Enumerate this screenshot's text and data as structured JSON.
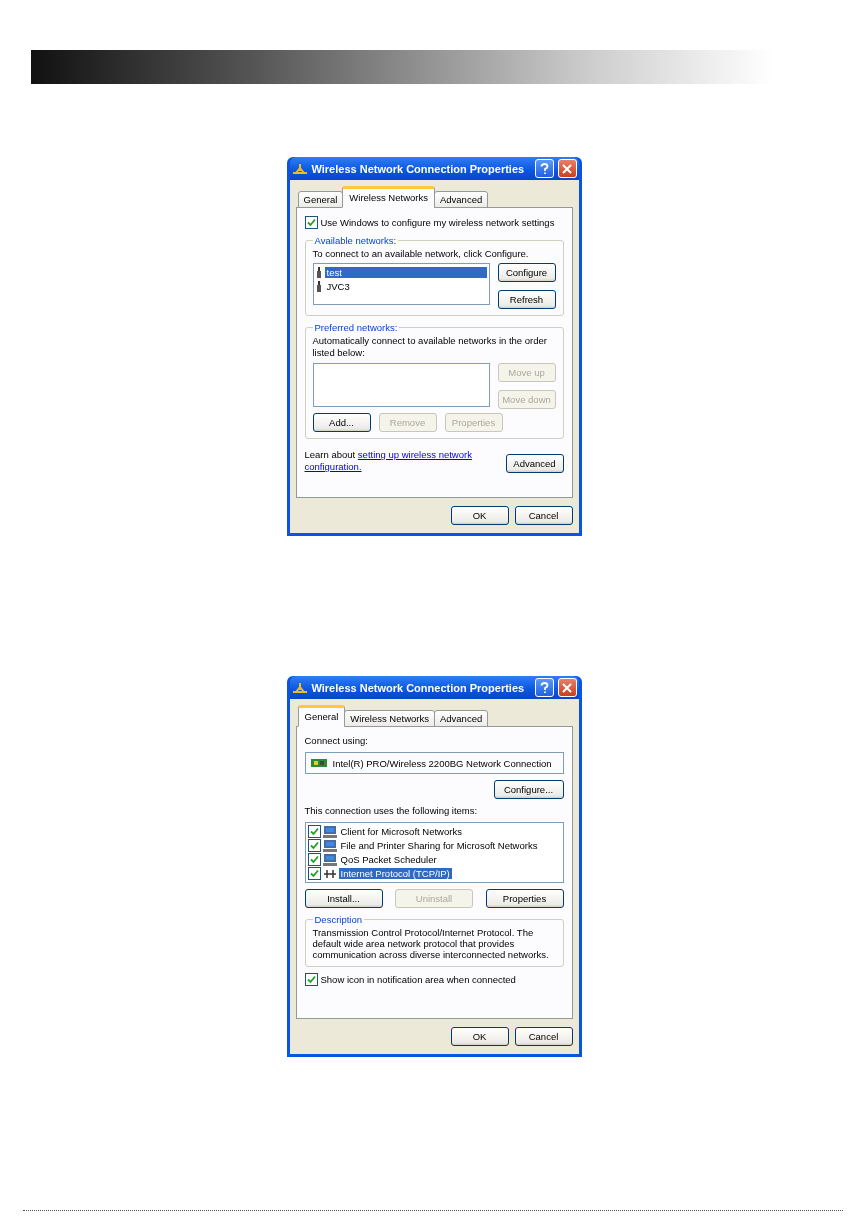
{
  "dialogs": [
    {
      "kind": "wireless",
      "title": "Wireless Network Connection Properties",
      "tabs": [
        {
          "label": "General",
          "selected": false
        },
        {
          "label": "Wireless Networks",
          "selected": true
        },
        {
          "label": "Advanced",
          "selected": false
        }
      ],
      "use_windows": {
        "label": "Use Windows to configure my wireless network settings",
        "checked": true
      },
      "available": {
        "legend": "Available networks:",
        "instruction": "To connect to an available network, click Configure.",
        "networks": [
          {
            "name": "test",
            "selected": true
          },
          {
            "name": "JVC3",
            "selected": false
          }
        ],
        "buttons": [
          {
            "label": "Configure",
            "disabled": false
          },
          {
            "label": "Refresh",
            "disabled": false
          }
        ]
      },
      "preferred": {
        "legend": "Preferred networks:",
        "instruction": "Automatically connect to available networks in the order listed below:",
        "side_buttons": [
          {
            "label": "Move up",
            "disabled": true
          },
          {
            "label": "Move down",
            "disabled": true
          }
        ],
        "buttons": [
          {
            "label": "Add...",
            "disabled": false
          },
          {
            "label": "Remove",
            "disabled": true
          },
          {
            "label": "Properties",
            "disabled": true
          }
        ]
      },
      "learn": {
        "text": "Learn about",
        "link_lines": [
          "setting up wireless network",
          "configuration."
        ]
      },
      "advanced_button": {
        "label": "Advanced",
        "disabled": false
      },
      "footer": [
        {
          "label": "OK",
          "disabled": false
        },
        {
          "label": "Cancel",
          "disabled": false
        }
      ]
    },
    {
      "kind": "general",
      "title": "Wireless Network Connection Properties",
      "tabs": [
        {
          "label": "General",
          "selected": true
        },
        {
          "label": "Wireless Networks",
          "selected": false
        },
        {
          "label": "Advanced",
          "selected": false
        }
      ],
      "connect_label": "Connect using:",
      "adapter": "Intel(R) PRO/Wireless 2200BG Network Connection",
      "configure_button": {
        "label": "Configure...",
        "disabled": false
      },
      "items_label": "This connection uses the following items:",
      "items": [
        {
          "label": "Client for Microsoft Networks",
          "checked": true,
          "selected": false,
          "kind": "computer"
        },
        {
          "label": "File and Printer Sharing for Microsoft Networks",
          "checked": true,
          "selected": false,
          "kind": "computer"
        },
        {
          "label": "QoS Packet Scheduler",
          "checked": true,
          "selected": false,
          "kind": "computer"
        },
        {
          "label": "Internet Protocol (TCP/IP)",
          "checked": true,
          "selected": true,
          "kind": "protocol"
        }
      ],
      "buttons": [
        {
          "label": "Install...",
          "disabled": false
        },
        {
          "label": "Uninstall",
          "disabled": true
        },
        {
          "label": "Properties",
          "disabled": false
        }
      ],
      "description": {
        "legend": "Description",
        "text": "Transmission Control Protocol/Internet Protocol. The default wide area network protocol that provides communication across diverse interconnected networks."
      },
      "show_icon": {
        "label": "Show icon in notification area when connected",
        "checked": true
      },
      "footer": [
        {
          "label": "OK",
          "disabled": false
        },
        {
          "label": "Cancel",
          "disabled": false
        }
      ]
    }
  ]
}
